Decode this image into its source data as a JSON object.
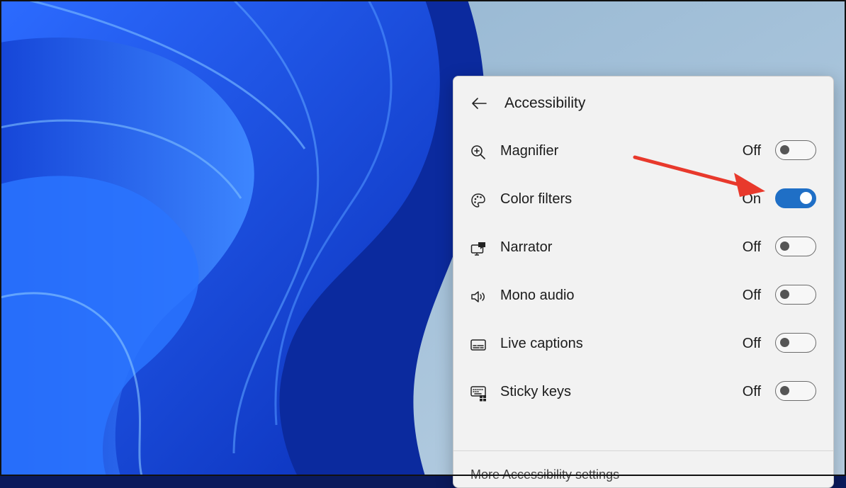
{
  "panel": {
    "title": "Accessibility",
    "back_icon": "back-arrow-icon",
    "items": [
      {
        "label": "Magnifier",
        "state": "Off",
        "icon": "magnifier-icon"
      },
      {
        "label": "Color filters",
        "state": "On",
        "icon": "palette-icon"
      },
      {
        "label": "Narrator",
        "state": "Off",
        "icon": "narrator-icon"
      },
      {
        "label": "Mono audio",
        "state": "Off",
        "icon": "speaker-icon"
      },
      {
        "label": "Live captions",
        "state": "Off",
        "icon": "captions-icon"
      },
      {
        "label": "Sticky keys",
        "state": "Off",
        "icon": "keyboard-icon"
      }
    ],
    "footer_link": "More Accessibility settings"
  },
  "colors": {
    "toggle_on": "#1f6fc6",
    "annotation_arrow": "#e8392c",
    "panel_bg": "#f2f2f2"
  }
}
